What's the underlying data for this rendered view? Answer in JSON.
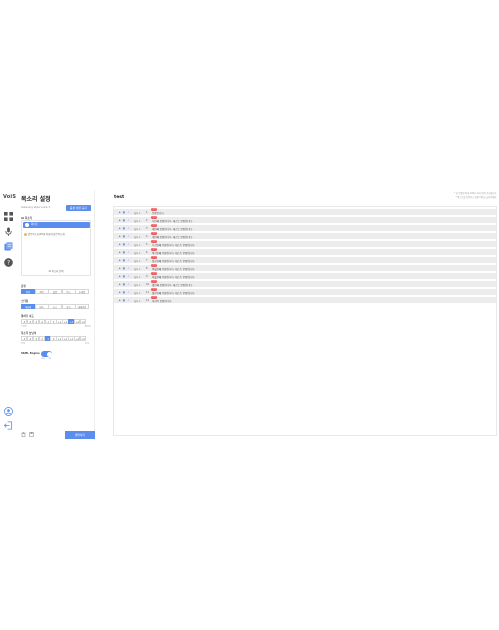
{
  "brand": "VoiS",
  "rail": {
    "icons": [
      "dashboard-icon",
      "microphone-icon",
      "documents-icon",
      "help-icon"
    ],
    "bottom_icons": [
      "account-icon",
      "logout-icon"
    ]
  },
  "panel": {
    "title": "목소리 설정",
    "subtitle": "Listening style voice 3",
    "sample_button": "음성 샘플 듣기",
    "voice_section": "AI 목소리",
    "selected_voice": "화이트",
    "voice_row": "밝은목소리(20대 여성의 밝은목소리)",
    "voice_footer": "AI 목소리 선택",
    "emotion_label": "감정",
    "emotions": [
      "중립",
      "행복",
      "슬픔",
      "분노",
      "두려움"
    ],
    "emotion_selected": 0,
    "style_label": "스타일",
    "styles": [
      "대화체",
      "낭독",
      "뉴스",
      "광고",
      "내레이션"
    ],
    "style_selected": 0,
    "speed_label": "말하기 속도",
    "speed_scale": [
      "-5",
      "-4",
      "-3",
      "-2",
      "-1",
      "0",
      "+1",
      "+2",
      "+3",
      "+4",
      "+5"
    ],
    "speed_selected": 8,
    "speed_caps": [
      "느리게",
      "빠르게"
    ],
    "pitch_label": "목소리 높낮이",
    "pitch_scale": [
      "-5",
      "-4",
      "-3",
      "-2",
      "-1",
      "0",
      "+1",
      "+2",
      "+3",
      "+4",
      "+5"
    ],
    "pitch_selected": 4,
    "pitch_caps": [
      "낮게",
      "높게"
    ],
    "ssml_label": "SSML Engine",
    "toggle_caps": [
      "OFF",
      "ON"
    ],
    "convert_button": "변환하기"
  },
  "main": {
    "doc_title": "test",
    "top_note_1": "* 한 문장당 최대 100자 까지 입력 가능합니다.",
    "top_note_2": "* 텍스트를 입력하고 변환 버튼을 눌러주세요.",
    "rows": [
      {
        "ctrl": "▶ ■ ↓",
        "speaker": "화자 1",
        "num": "1",
        "tag": "감정",
        "text": "문장입니다."
      },
      {
        "ctrl": "▶ ■ ↓",
        "speaker": "화자 1",
        "num": "2",
        "tag": "감정",
        "text": "두번째 문장입니다. 테스트 문장입니다."
      },
      {
        "ctrl": "▶ ■ ↓",
        "speaker": "화자 1",
        "num": "3",
        "tag": "감정",
        "text": "세번째 문장입니다. 테스트 문장입니다."
      },
      {
        "ctrl": "▶ ■ ↓",
        "speaker": "화자 1",
        "num": "4",
        "tag": "감정",
        "text": "네번째 문장입니다. 테스트 문장입니다."
      },
      {
        "ctrl": "▶ ■ ↓",
        "speaker": "화자 1",
        "num": "5",
        "tag": "감정",
        "text": "다섯번째 문장입니다. 테스트 문장입니다."
      },
      {
        "ctrl": "▶ ■ ↓",
        "speaker": "화자 1",
        "num": "6",
        "tag": "감정",
        "text": "여섯번째 문장입니다. 테스트 문장입니다."
      },
      {
        "ctrl": "▶ ■ ↓",
        "speaker": "화자 1",
        "num": "7",
        "tag": "감정",
        "text": "일곱번째 문장입니다. 테스트 문장입니다."
      },
      {
        "ctrl": "▶ ■ ↓",
        "speaker": "화자 1",
        "num": "8",
        "tag": "감정",
        "text": "여덟번째 문장입니다. 테스트 문장입니다."
      },
      {
        "ctrl": "▶ ■ ↓",
        "speaker": "화자 1",
        "num": "9",
        "tag": "감정",
        "text": "아홉번째 문장입니다. 테스트 문장입니다."
      },
      {
        "ctrl": "▶ ■ ↓",
        "speaker": "화자 1",
        "num": "10",
        "tag": "감정",
        "text": "열번째 문장입니다. 테스트 문장입니다."
      },
      {
        "ctrl": "▶ ■ ↓",
        "speaker": "화자 1",
        "num": "11",
        "tag": "감정",
        "text": "열한번째 문장입니다. 테스트 문장입니다."
      },
      {
        "ctrl": "▶ ■ ↓",
        "speaker": "화자 1",
        "num": "12",
        "tag": "감정",
        "text": "마지막 문장입니다."
      }
    ]
  },
  "colors": {
    "accent": "#5b8def",
    "tag": "#f05a5a",
    "row_bg": "#ececec"
  }
}
